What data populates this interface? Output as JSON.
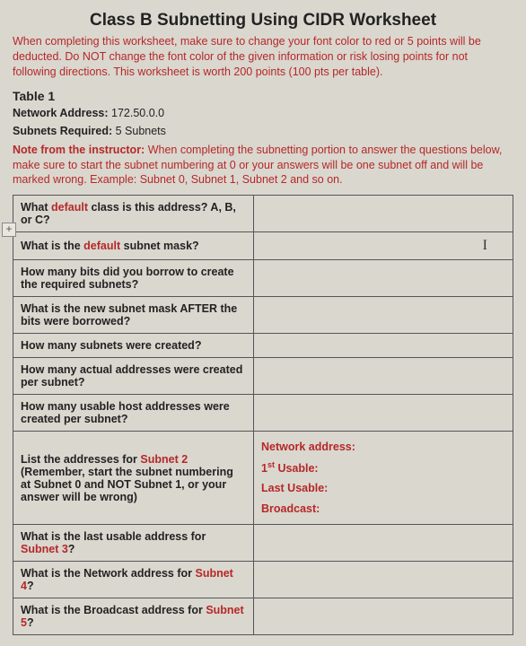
{
  "title": "Class B Subnetting Using CIDR Worksheet",
  "instructions": "When completing this worksheet, make sure to change your font color to red or 5 points will be deducted. Do NOT change the font color of the given information or risk losing points for not following directions. This worksheet is worth 200 points (100 pts per table).",
  "table_label": "Table 1",
  "network_address_label": "Network Address:",
  "network_address_value": "172.50.0.0",
  "subnets_required_label": "Subnets Required:",
  "subnets_required_value": "5 Subnets",
  "note_label": "Note from the instructor:",
  "note_text": "When completing the subnetting portion to answer the questions below, make sure to start the subnet numbering at 0 or your answers will be one subnet off and will be marked wrong. Example: Subnet 0, Subnet 1, Subnet 2 and so on.",
  "plus_symbol": "+",
  "cursor_glyph": "I",
  "q1_a": "What ",
  "q1_b": "default",
  "q1_c": " class is this address? A, B, or C?",
  "q2_a": "What is the ",
  "q2_b": "default",
  "q2_c": " subnet mask?",
  "q3": "How many bits did you borrow to create the required subnets?",
  "q4": "What is the new subnet mask AFTER the bits were borrowed?",
  "q5": "How many subnets were created?",
  "q6": "How many actual addresses were created per subnet?",
  "q7": "How many usable host addresses were created per subnet?",
  "q8_a": "List the addresses for ",
  "q8_b": "Subnet 2",
  "q8_c": " (Remember, start the subnet numbering at Subnet 0 and NOT Subnet 1, or your answer will be wrong)",
  "q8_ans_net": "Network address:",
  "q8_ans_first_a": "1",
  "q8_ans_first_b": "st",
  "q8_ans_first_c": " Usable:",
  "q8_ans_last": "Last Usable:",
  "q8_ans_bc": "Broadcast:",
  "q9_a": "What is the last usable address for ",
  "q9_b": "Subnet 3",
  "q9_c": "?",
  "q10_a": "What is the Network address for ",
  "q10_b": "Subnet 4",
  "q10_c": "?",
  "q11_a": "What is the Broadcast address for ",
  "q11_b": "Subnet 5",
  "q11_c": "?"
}
